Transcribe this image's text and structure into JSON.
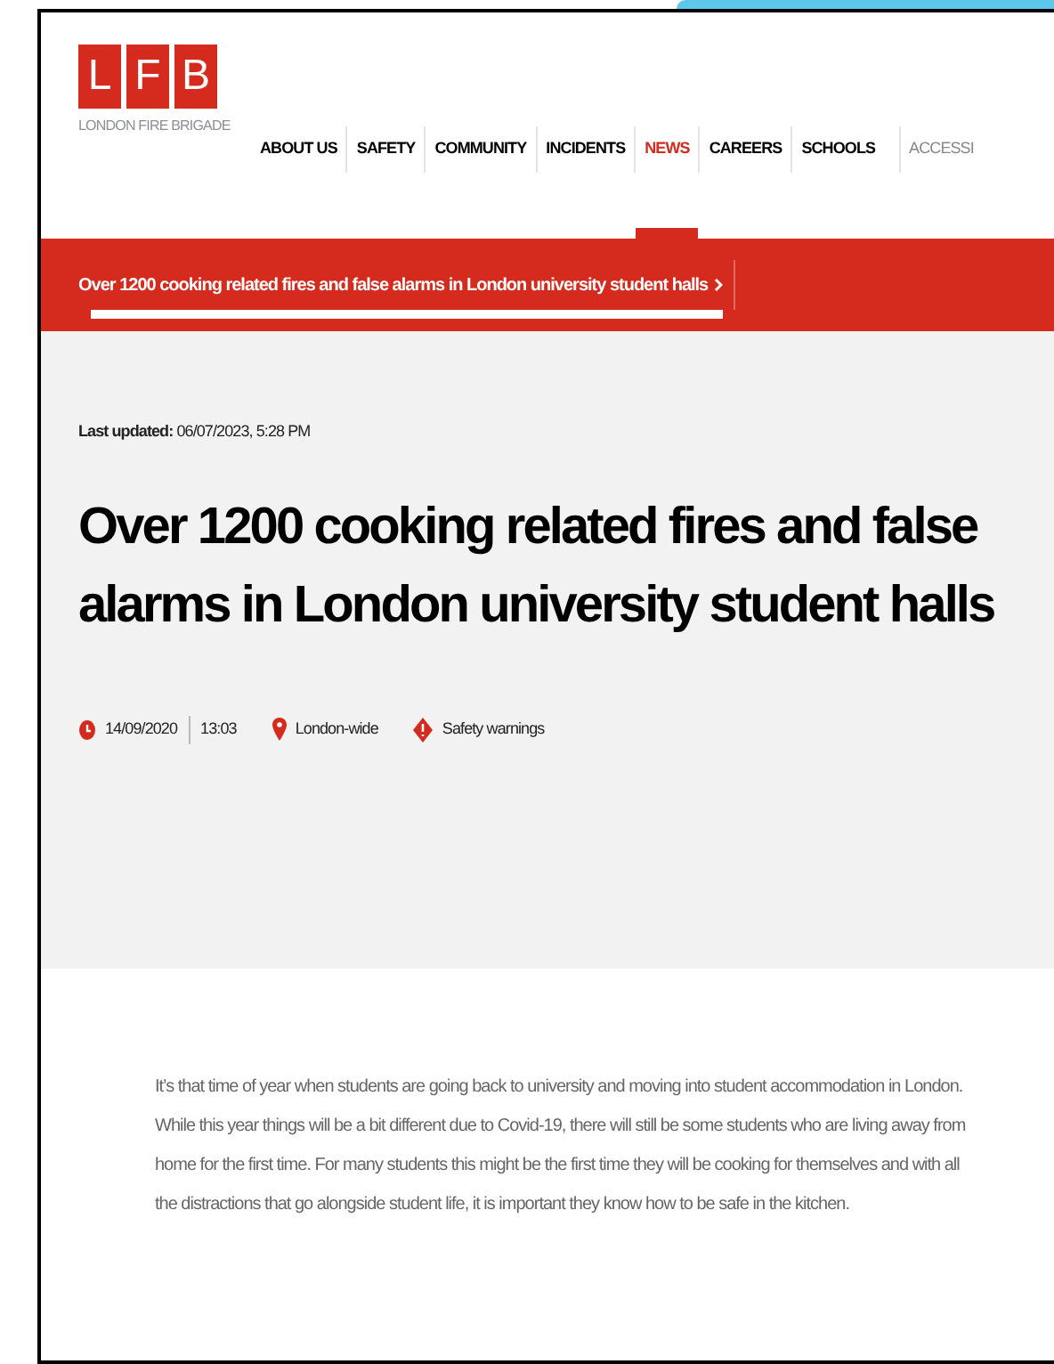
{
  "logo": {
    "letters": [
      "L",
      "F",
      "B"
    ],
    "caption": "LONDON FIRE BRIGADE"
  },
  "nav": [
    {
      "label": "ABOUT US",
      "selected": false,
      "muted": false
    },
    {
      "label": "SAFETY",
      "selected": false,
      "muted": false
    },
    {
      "label": "COMMUNITY",
      "selected": false,
      "muted": false
    },
    {
      "label": "INCIDENTS",
      "selected": false,
      "muted": false
    },
    {
      "label": "NEWS",
      "selected": true,
      "muted": false
    },
    {
      "label": "CAREERS",
      "selected": false,
      "muted": false
    },
    {
      "label": "SCHOOLS",
      "selected": false,
      "muted": false
    },
    {
      "label": "ACCESSI",
      "selected": false,
      "muted": true
    }
  ],
  "breadcrumb": {
    "label": "Over 1200 cooking related fires and false alarms in London university student halls",
    "selected": true
  },
  "article": {
    "last_updated": "**Last updated:** 06/07/2023, 5:28 PM",
    "title": "Over 1200 cooking related fires and false alarms in London university student halls",
    "date": "14/09/2020",
    "time": "13:03",
    "location": "London-wide",
    "category": "Safety warnings",
    "intro": "It’s that time of year when students are going back to university and moving into student accommodation in London. While this year things will be a bit different due to Covid-19, there will still be some students who are living away from home for the first time. For many students this might be the first time they will be cooking for themselves and with all the distractions that go alongside student life, it is important they know how to be safe in the kitchen."
  }
}
